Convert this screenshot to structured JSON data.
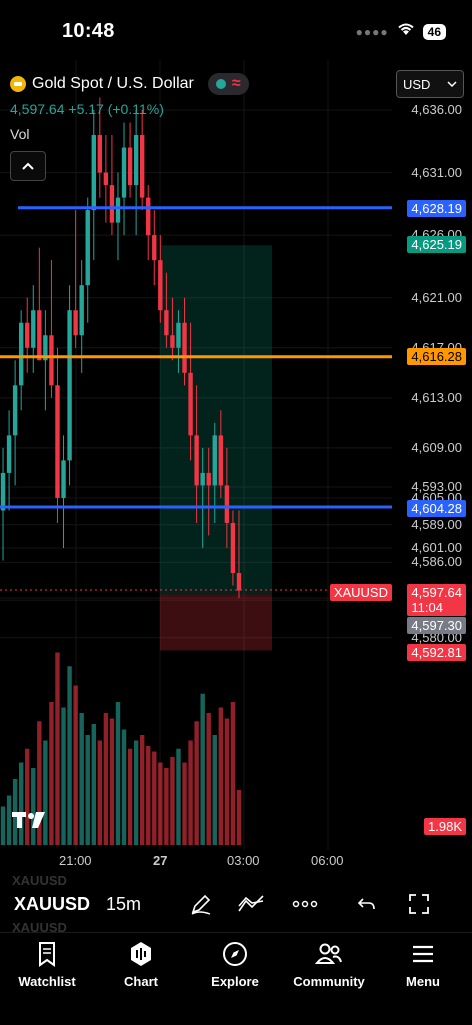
{
  "status_bar": {
    "time": "10:48",
    "battery": "46"
  },
  "header": {
    "symbol_name": "Gold Spot / U.S. Dollar",
    "price": "4,597.64",
    "change": "+5.17 (+0.11%)",
    "vol_label": "Vol",
    "currency": "USD"
  },
  "price_axis": [
    "4,636.00",
    "4,631.00",
    "4,626.00",
    "4,621.00",
    "4,617.00",
    "4,613.00",
    "4,609.00",
    "4,605.00",
    "4,601.00",
    "4,597.00",
    "4,593.00",
    "4,589.00",
    "4,586.00",
    "4,583.00",
    "4,580.00"
  ],
  "tags": {
    "line_blue_top": "4,628.19",
    "target": "4,625.19",
    "line_orange": "4,616.28",
    "line_blue_bottom": "4,604.28",
    "symbol": "XAUUSD",
    "last_price": "4,597.64",
    "countdown": "11:04",
    "entry": "4,597.30",
    "stop": "4,592.81",
    "volume": "1.98K"
  },
  "time_axis": [
    "21:00",
    "27",
    "03:00",
    "06:00"
  ],
  "toolbar": {
    "symbol": "XAUUSD",
    "interval": "15m",
    "ghost_symbol": "XAUUSD"
  },
  "nav": {
    "watchlist": "Watchlist",
    "chart": "Chart",
    "explore": "Explore",
    "community": "Community",
    "menu": "Menu"
  },
  "colors": {
    "up": "#26a69a",
    "down": "#f23645",
    "blue_line": "#2962ff",
    "orange_line": "#ff9800"
  },
  "chart_data": {
    "type": "candlestick",
    "symbol": "XAUUSD",
    "interval": "15m",
    "ylim": [
      4580,
      4637
    ],
    "horizontal_lines": [
      4628.19,
      4616.28,
      4604.28
    ],
    "position": {
      "entry": 4597.3,
      "target": 4625.19,
      "stop": 4592.81
    },
    "candles": [
      [
        4604,
        4609,
        4600,
        4607
      ],
      [
        4607,
        4612,
        4604,
        4610
      ],
      [
        4610,
        4616,
        4606,
        4614
      ],
      [
        4614,
        4620,
        4612,
        4619
      ],
      [
        4619,
        4621,
        4615,
        4617
      ],
      [
        4617,
        4622,
        4615,
        4620
      ],
      [
        4620,
        4625,
        4617,
        4616
      ],
      [
        4616,
        4620,
        4612,
        4618
      ],
      [
        4618,
        4624,
        4613,
        4614
      ],
      [
        4614,
        4617,
        4603,
        4605
      ],
      [
        4605,
        4610,
        4601,
        4608
      ],
      [
        4608,
        4622,
        4606,
        4620
      ],
      [
        4620,
        4628,
        4617,
        4618
      ],
      [
        4618,
        4624,
        4615,
        4622
      ],
      [
        4622,
        4629,
        4619,
        4628
      ],
      [
        4628,
        4636,
        4624,
        4634
      ],
      [
        4634,
        4637,
        4629,
        4631
      ],
      [
        4631,
        4634,
        4627,
        4630
      ],
      [
        4630,
        4634,
        4626,
        4627
      ],
      [
        4627,
        4631,
        4624,
        4629
      ],
      [
        4629,
        4635,
        4626,
        4633
      ],
      [
        4633,
        4635,
        4629,
        4630
      ],
      [
        4630,
        4636,
        4626,
        4634
      ],
      [
        4634,
        4636,
        4628,
        4629
      ],
      [
        4629,
        4630,
        4624,
        4626
      ],
      [
        4626,
        4628,
        4622,
        4624
      ],
      [
        4624,
        4626,
        4619,
        4620
      ],
      [
        4620,
        4623,
        4617,
        4618
      ],
      [
        4618,
        4621,
        4616,
        4617
      ],
      [
        4617,
        4620,
        4615,
        4619
      ],
      [
        4619,
        4621,
        4614,
        4615
      ],
      [
        4615,
        4619,
        4608,
        4610
      ],
      [
        4610,
        4614,
        4603,
        4606
      ],
      [
        4606,
        4609,
        4601,
        4607
      ],
      [
        4607,
        4609,
        4602,
        4606
      ],
      [
        4606,
        4611,
        4603,
        4610
      ],
      [
        4610,
        4612,
        4605,
        4606
      ],
      [
        4606,
        4609,
        4601,
        4603
      ],
      [
        4603,
        4604,
        4598,
        4599
      ],
      [
        4599,
        4604,
        4597,
        4597.6
      ]
    ],
    "volume": [
      14,
      18,
      24,
      30,
      35,
      28,
      45,
      38,
      52,
      70,
      50,
      65,
      58,
      48,
      40,
      44,
      38,
      48,
      46,
      52,
      42,
      35,
      38,
      40,
      36,
      34,
      30,
      28,
      32,
      35,
      30,
      38,
      45,
      55,
      48,
      40,
      50,
      46,
      52,
      20
    ]
  }
}
